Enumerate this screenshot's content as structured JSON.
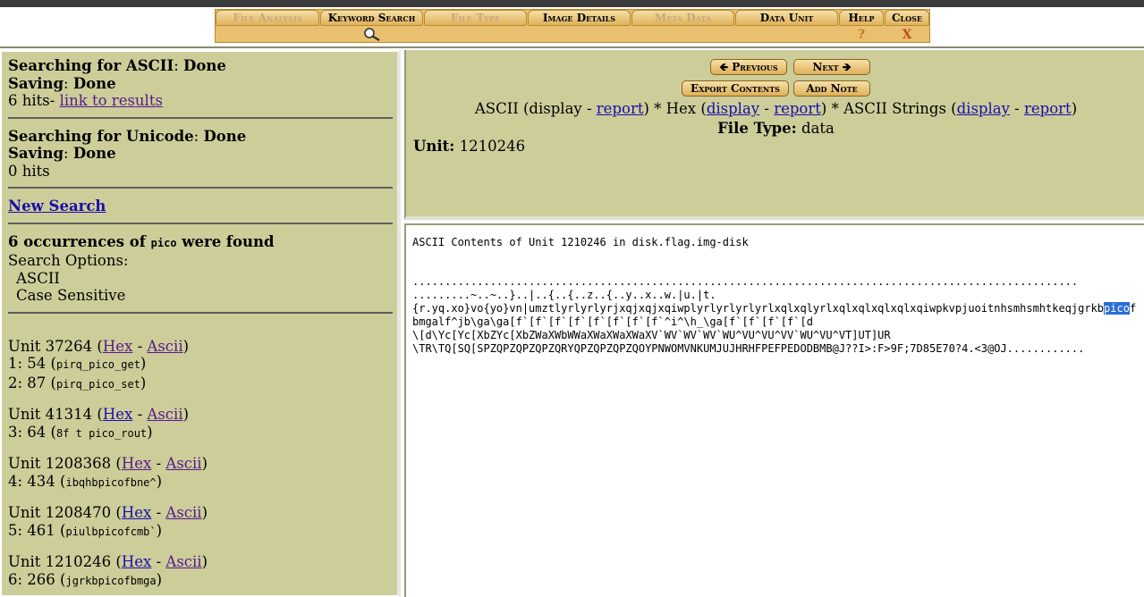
{
  "menu": {
    "tabs": [
      {
        "label": "File Analysis",
        "disabled": true
      },
      {
        "label": "Keyword Search",
        "disabled": false
      },
      {
        "label": "File Type",
        "disabled": true
      },
      {
        "label": "Image Details",
        "disabled": false
      },
      {
        "label": "Meta Data",
        "disabled": true
      },
      {
        "label": "Data Unit",
        "disabled": false
      },
      {
        "label": "Help",
        "disabled": false
      },
      {
        "label": "Close",
        "disabled": false
      }
    ],
    "help_symbol": "?",
    "close_symbol": "X",
    "keyword_icon": "magnifier-icon"
  },
  "left": {
    "ascii_search_label": "Searching for ASCII",
    "ascii_search_status": "Done",
    "saving_label": "Saving",
    "saving_status": "Done",
    "ascii_hits": "6 hits-",
    "results_link": "link to results",
    "unicode_search_label": "Searching for Unicode",
    "unicode_search_status": "Done",
    "saving2_label": "Saving",
    "saving2_status": "Done",
    "unicode_hits": "0 hits",
    "new_search": "New Search",
    "occurrences_prefix": "6 occurrences of",
    "keyword": "pico",
    "occurrences_suffix": "were found",
    "search_options_label": "Search Options:",
    "option1": "ASCII",
    "option2": "Case Sensitive",
    "units": [
      {
        "unit": "Unit 37264",
        "hex": "Hex",
        "ascii": "Ascii",
        "hits": [
          {
            "pos": "1: 54",
            "ctx": "pirq_pico_get"
          },
          {
            "pos": "2: 87",
            "ctx": "pirq_pico_set"
          }
        ]
      },
      {
        "unit": "Unit 41314",
        "hex": "Hex",
        "ascii": "Ascii",
        "hits": [
          {
            "pos": "3: 64",
            "ctx": "8f t pico_rout"
          }
        ]
      },
      {
        "unit": "Unit 1208368",
        "hex": "Hex",
        "ascii": "Ascii",
        "hits": [
          {
            "pos": "4: 434",
            "ctx": "ibqhbpicofbne^"
          }
        ]
      },
      {
        "unit": "Unit 1208470",
        "hex": "Hex",
        "ascii": "Ascii",
        "hits": [
          {
            "pos": "5: 461",
            "ctx": "piulbpicofcmb`"
          }
        ]
      },
      {
        "unit": "Unit 1210246",
        "hex": "Hex",
        "ascii": "Ascii",
        "hits": [
          {
            "pos": "6: 266",
            "ctx": "jgrkbpicofbmga"
          }
        ]
      }
    ]
  },
  "right": {
    "previous": "Previous",
    "next": "Next",
    "export": "Export Contents",
    "add_note": "Add Note",
    "ascii_label": "ASCII (display -",
    "report": "report",
    "hex_label": "Hex (",
    "display": "display",
    "strings_label": "ASCII Strings (",
    "filetype_label": "File Type:",
    "filetype_value": "data",
    "unit_label": "Unit:",
    "unit_value": "1210246",
    "ascii_title": "ASCII Contents of Unit 1210246 in disk.flag.img-disk",
    "line1": ".......................................................................................................",
    "line2": ".........~..~..}..|..{..{..z..{..y..x..w.|u.|t.",
    "line3_pre": "{r.yq.xo}vo{yo}vn|umztlyrlyrlyrjxqjxqjxqiwplyrlyrlyrlyrlxqlxqlyrlxqlxqlxqlxqlxqiwpkvpjuoitnhsmhsmhtkeqjgrkb",
    "line3_hl": "pico",
    "line3_post": "f",
    "line4": "bmgalf^jb\\ga\\ga[f`[f`[f`[f`[f`[f`[f`[f`^i^\\h_\\ga[f`[f`[f`[f`[d",
    "line5": "\\[d\\Yc[Yc[XbZYc[XbZWaXWbWWaXWaXWaXWaXV`WV`WV`WV`WU^VU^VU^VV`WU^VU^VT]UT]UR",
    "line6": "\\TR\\TQ[SQ[SPZQPZQPZQPZQRYQPZQPZQPZQOYPNWOMVNKUMJUJHRHFPEFPEDODBMB@J??I>:F>9F;7D85E70?4.<3@OJ............"
  }
}
